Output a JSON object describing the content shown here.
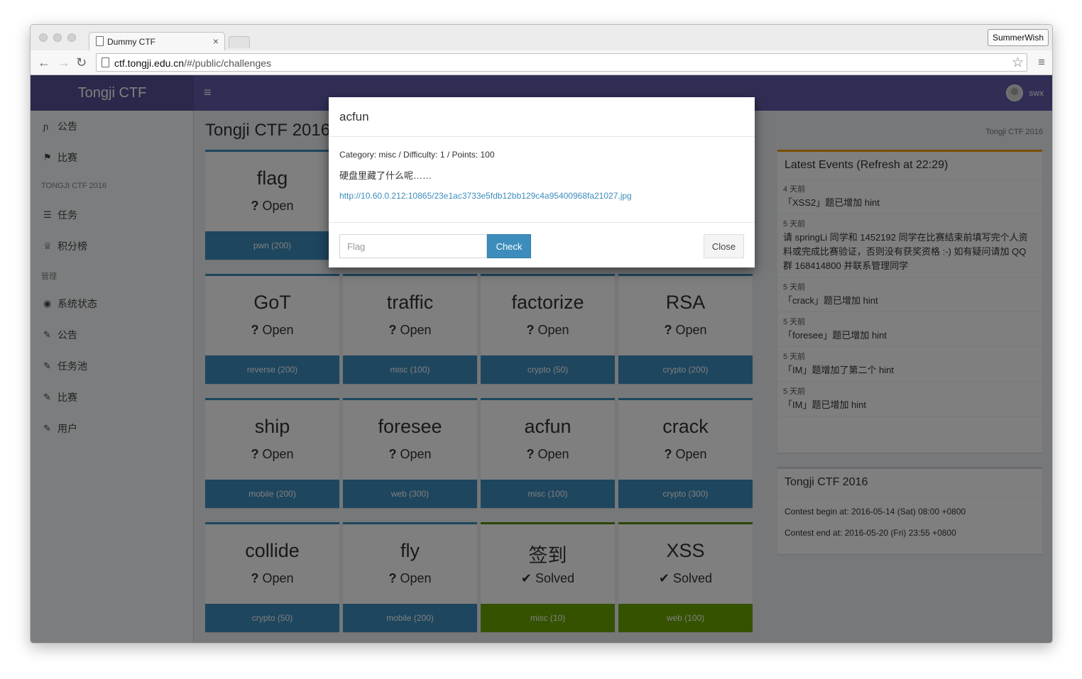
{
  "browser": {
    "tab_title": "Dummy CTF",
    "tab_close": "×",
    "profile": "SummerWish",
    "url_host": "ctf.tongji.edu.cn",
    "url_path": "/#/public/challenges"
  },
  "icons": {
    "back": "←",
    "forward": "→",
    "reload": "↻",
    "star": "☆",
    "menu": "≡",
    "burger": "≡"
  },
  "header": {
    "brand": "Tongji CTF",
    "username": "swx"
  },
  "sidebar": {
    "items": [
      {
        "icon": "ɲ",
        "label": "公告"
      },
      {
        "icon": "⚑",
        "label": "比赛"
      },
      {
        "icon": "☰",
        "label": "任务"
      },
      {
        "icon": "♕",
        "label": "积分榜"
      },
      {
        "icon": "◉",
        "label": "系统状态"
      },
      {
        "icon": "✎",
        "label": "公告"
      },
      {
        "icon": "✎",
        "label": "任务池"
      },
      {
        "icon": "✎",
        "label": "比赛"
      },
      {
        "icon": "✎",
        "label": "用户"
      }
    ],
    "headers": [
      "TONGJI CTF 2016",
      "管理"
    ]
  },
  "content": {
    "title": "Tongji CTF 2016",
    "breadcrumb": "Tongji CTF 2016"
  },
  "challenges": [
    {
      "name": "flag",
      "status_icon": "?",
      "status": "Open",
      "footer": "pwn (200)"
    },
    {
      "name": "GoT",
      "status_icon": "?",
      "status": "Open",
      "footer": "reverse (200)"
    },
    {
      "name": "traffic",
      "status_icon": "?",
      "status": "Open",
      "footer": "misc (100)"
    },
    {
      "name": "factorize",
      "status_icon": "?",
      "status": "Open",
      "footer": "crypto (50)"
    },
    {
      "name": "RSA",
      "status_icon": "?",
      "status": "Open",
      "footer": "crypto (200)"
    },
    {
      "name": "ship",
      "status_icon": "?",
      "status": "Open",
      "footer": "mobile (200)"
    },
    {
      "name": "foresee",
      "status_icon": "?",
      "status": "Open",
      "footer": "web (300)"
    },
    {
      "name": "acfun",
      "status_icon": "?",
      "status": "Open",
      "footer": "misc (100)"
    },
    {
      "name": "crack",
      "status_icon": "?",
      "status": "Open",
      "footer": "crypto (300)"
    },
    {
      "name": "collide",
      "status_icon": "?",
      "status": "Open",
      "footer": "crypto (50)"
    },
    {
      "name": "fly",
      "status_icon": "?",
      "status": "Open",
      "footer": "mobile (200)"
    },
    {
      "name": "签到",
      "status_icon": "✔",
      "status": "Solved",
      "footer": "misc (10)"
    },
    {
      "name": "XSS",
      "status_icon": "✔",
      "status": "Solved",
      "footer": "web (100)"
    }
  ],
  "events": {
    "title": "Latest Events (Refresh at 22:29)",
    "items": [
      {
        "time": "4 天前",
        "text": "「XSS2」题已增加 hint"
      },
      {
        "time": "5 天前",
        "text": "请 springLi 同学和 1452192 同学在比赛结束前填写完个人资料或完成比赛验证，否则没有获奖资格 :-) 如有疑问请加 QQ 群 168414800 并联系管理同学"
      },
      {
        "time": "5 天前",
        "text": "「crack」题已增加 hint"
      },
      {
        "time": "5 天前",
        "text": "「foresee」题已增加 hint"
      },
      {
        "time": "5 天前",
        "text": "「IM」题增加了第二个 hint"
      },
      {
        "time": "5 天前",
        "text": "「IM」题已增加 hint"
      }
    ]
  },
  "info": {
    "title": "Tongji CTF 2016",
    "begin": "Contest begin at: 2016-05-14 (Sat) 08:00 +0800",
    "end": "Contest end at: 2016-05-20 (Fri) 23:55 +0800"
  },
  "modal": {
    "title": "acfun",
    "meta": "Category: misc / Difficulty: 1 / Points: 100",
    "description": "硬盘里藏了什么呢……",
    "link": "http://10.60.0.212:10865/23e1ac3733e5fdb12bb129c4a95400968fa21027.jpg",
    "flag_placeholder": "Flag",
    "flag_value": "",
    "check_label": "Check",
    "close_label": "Close"
  },
  "colors": {
    "accent": "#3c8dbc",
    "header": "#605ca8",
    "solved": "#6aa500",
    "events_border": "#f39c12"
  }
}
